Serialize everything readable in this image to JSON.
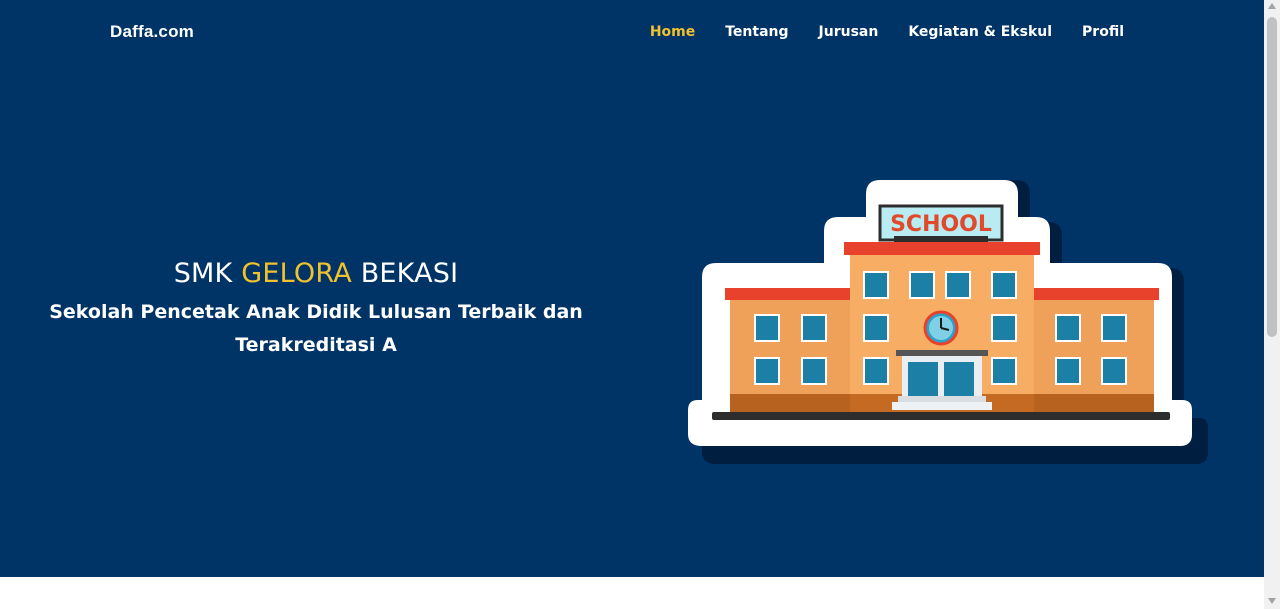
{
  "navbar": {
    "brand": "Daffa.com",
    "links": [
      {
        "label": "Home",
        "active": true
      },
      {
        "label": "Tentang",
        "active": false
      },
      {
        "label": "Jurusan",
        "active": false
      },
      {
        "label": "Kegiatan & Ekskul",
        "active": false
      },
      {
        "label": "Profil",
        "active": false
      }
    ]
  },
  "hero": {
    "title_prefix": "SMK",
    "title_highlight": "GELORA",
    "title_suffix": "BEKASI",
    "subtitle": "Sekolah Pencetak Anak Didik Lulusan Terbaik dan Terakreditasi A",
    "illustration": {
      "sign_text": "SCHOOL",
      "icon": "school-building-icon"
    }
  },
  "colors": {
    "hero_background": "#003366",
    "accent": "#f2c12e",
    "text": "#ffffff"
  }
}
